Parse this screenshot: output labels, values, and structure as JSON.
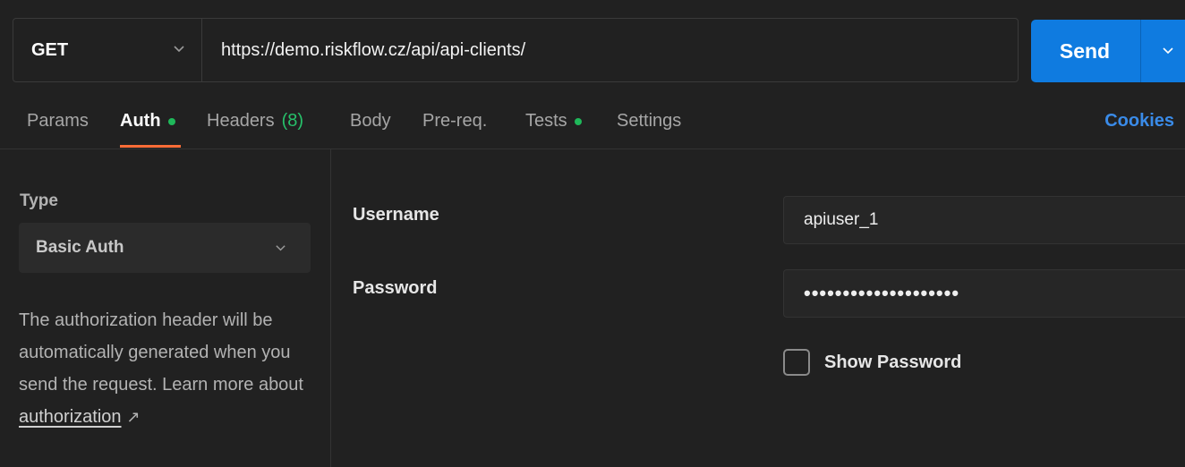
{
  "request": {
    "method": "GET",
    "url": "https://demo.riskflow.cz/api/api-clients/",
    "send_label": "Send"
  },
  "tabs": {
    "params": "Params",
    "auth": "Auth",
    "headers": "Headers",
    "headers_count": "(8)",
    "body": "Body",
    "prereq": "Pre-req.",
    "tests": "Tests",
    "settings": "Settings",
    "cookies": "Cookies",
    "active": "Auth"
  },
  "auth": {
    "type_label": "Type",
    "type_value": "Basic Auth",
    "description": "The authorization header will be automatically generated when you send the request. Learn more about",
    "link_text": "authorization",
    "link_icon": "external-link-arrow-icon",
    "username_label": "Username",
    "username_value": "apiuser_1",
    "password_label": "Password",
    "password_value": "••••••••••••••••••••",
    "show_password_label": "Show Password",
    "show_password_checked": false
  },
  "colors": {
    "background": "#212121",
    "accent_send": "#0f7be0",
    "active_tab_underline": "#ff6c37",
    "status_dot": "#1fb85a",
    "cookies_link": "#3a8be8"
  }
}
